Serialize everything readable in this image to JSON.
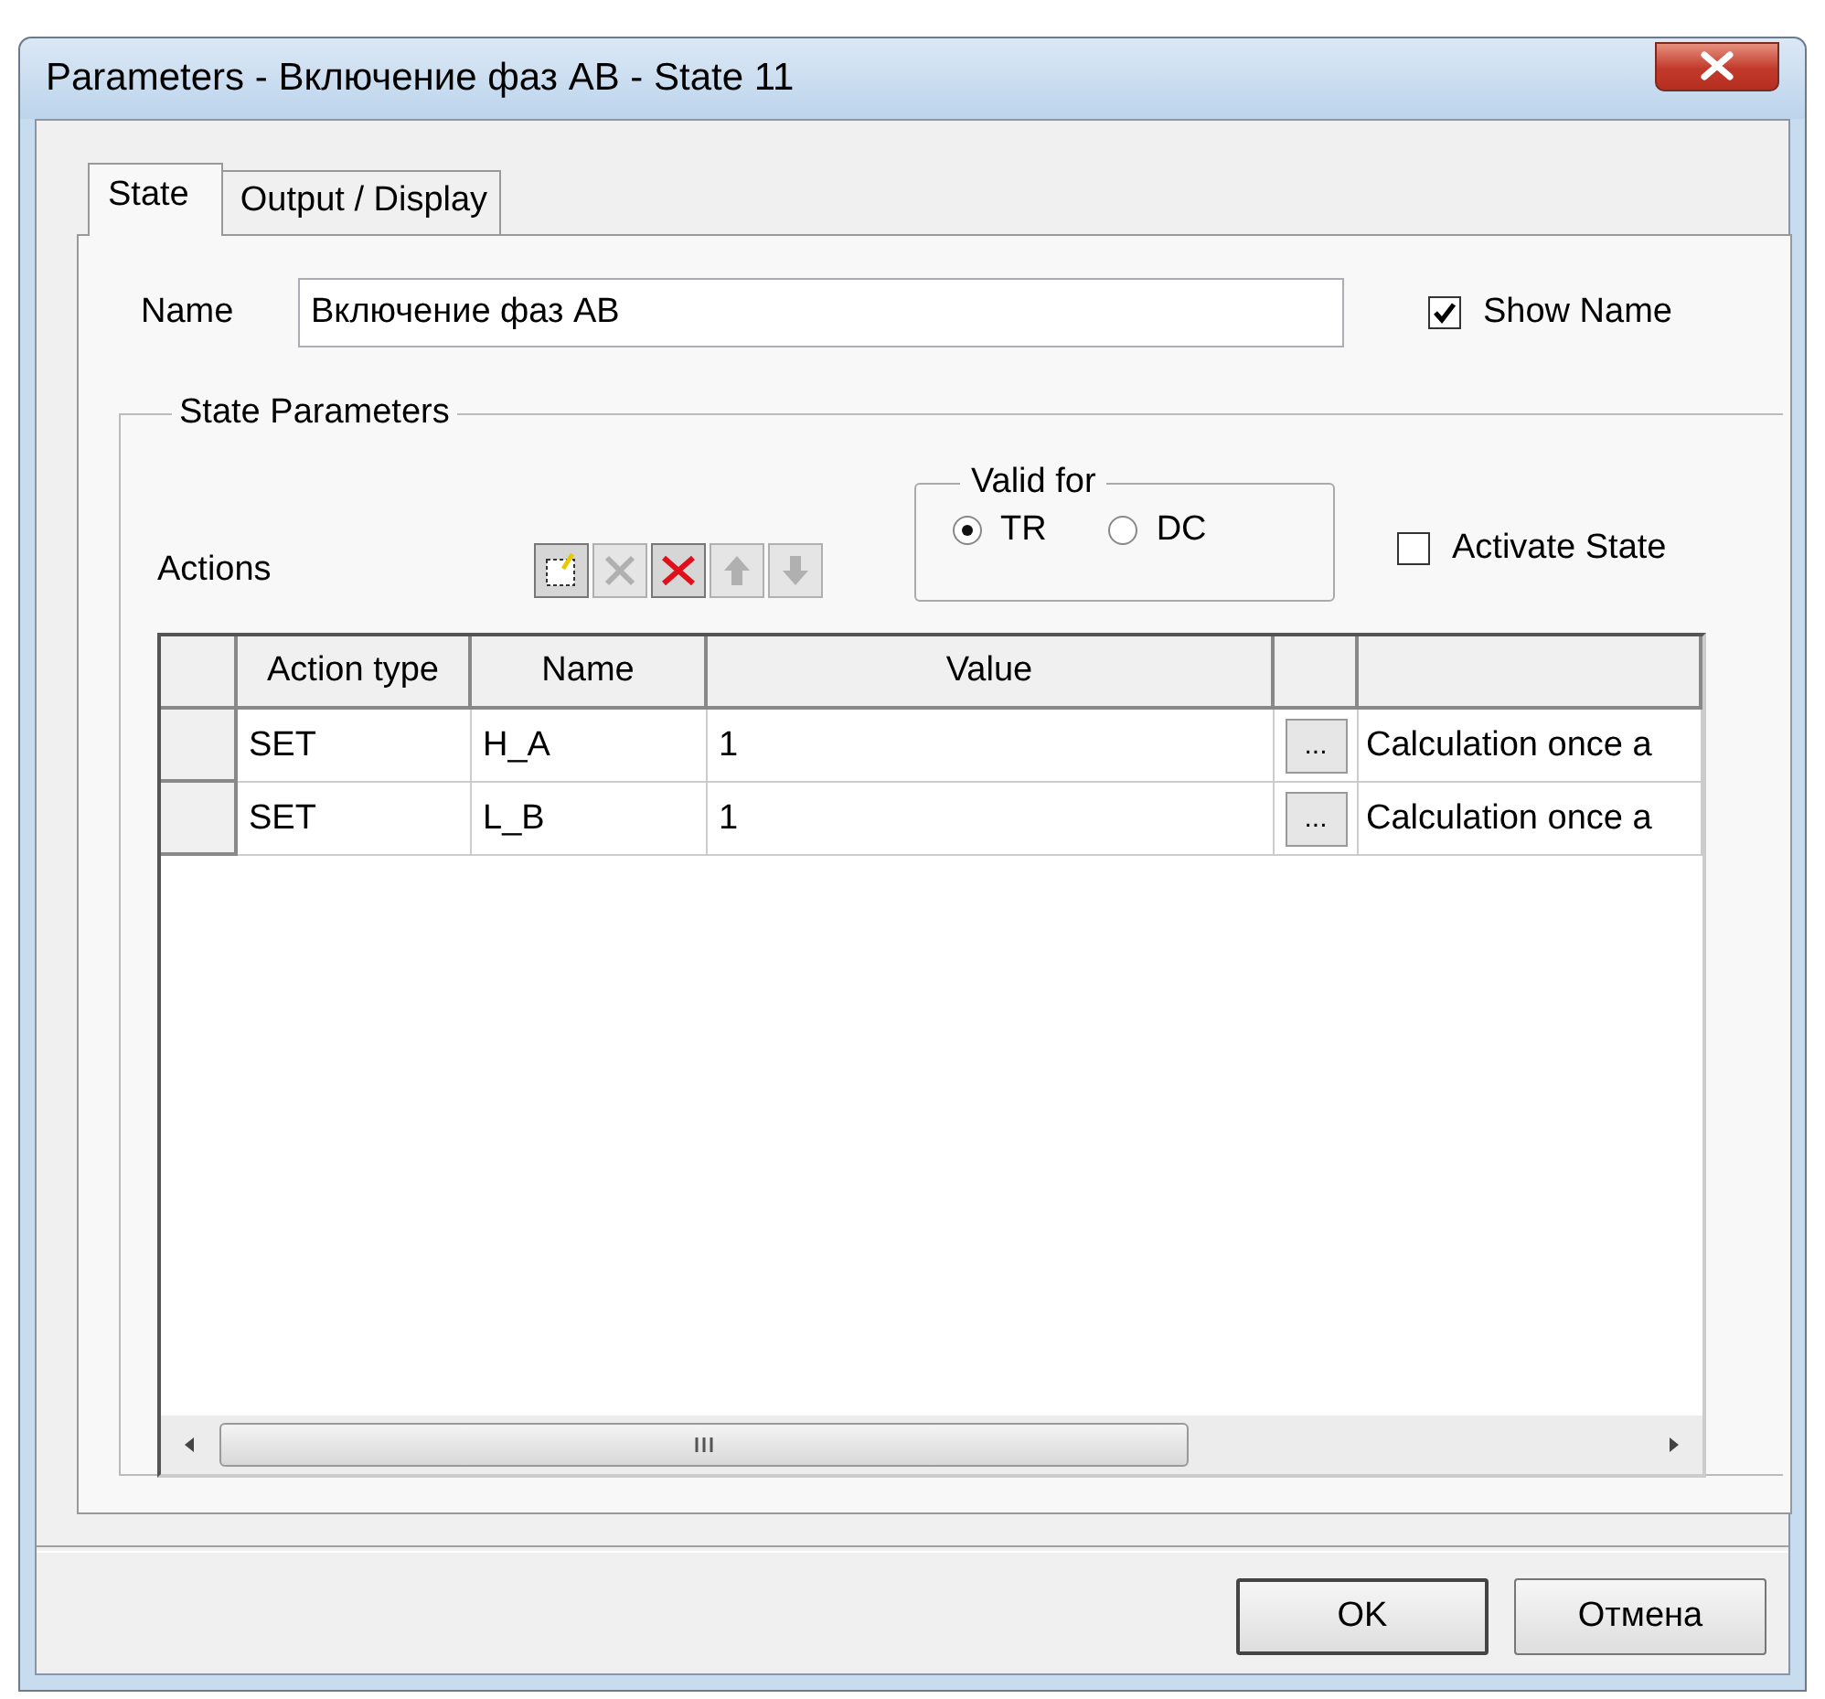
{
  "window": {
    "title": "Parameters - Включение фаз AB - State 11"
  },
  "tabs": [
    {
      "label": "State",
      "selected": true
    },
    {
      "label": "Output / Display",
      "selected": false
    }
  ],
  "name_field": {
    "label": "Name",
    "value": "Включение фаз AB"
  },
  "show_name": {
    "label": "Show Name",
    "checked": true
  },
  "state_parameters": {
    "title": "State Parameters",
    "actions_label": "Actions",
    "toolbar": [
      {
        "kind": "new",
        "disabled": false
      },
      {
        "kind": "delete",
        "disabled": true
      },
      {
        "kind": "delete_all",
        "disabled": false
      },
      {
        "kind": "up",
        "disabled": true
      },
      {
        "kind": "down",
        "disabled": true
      }
    ],
    "valid_for": {
      "title": "Valid for",
      "options": [
        {
          "label": "TR",
          "selected": true
        },
        {
          "label": "DC",
          "selected": false
        }
      ]
    },
    "activate_state": {
      "label": "Activate State",
      "checked": false
    },
    "table": {
      "columns": [
        "Action type",
        "Name",
        "Value"
      ],
      "rows": [
        {
          "action_type": "SET",
          "name": "H_A",
          "value": "1",
          "button": "...",
          "column_5": "Calculation once a"
        },
        {
          "action_type": "SET",
          "name": "L_B",
          "value": "1",
          "button": "...",
          "column_5": "Calculation once a"
        }
      ]
    }
  },
  "buttons": [
    {
      "label": "OK",
      "default": true
    },
    {
      "label": "Отмена",
      "default": false
    }
  ]
}
